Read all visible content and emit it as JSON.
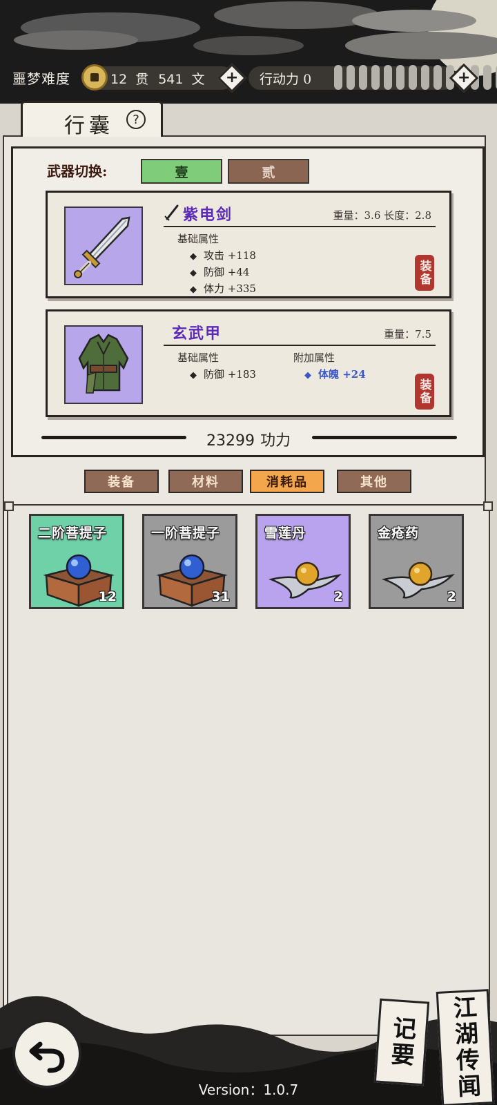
{
  "header": {
    "difficulty": "噩梦难度",
    "money_guan": "12",
    "money_guan_unit": "贯",
    "money_wen": "541",
    "money_wen_unit": "文",
    "action_label": "行动力",
    "action_value": "0",
    "stamina_bars_total": 14
  },
  "panel": {
    "title": "行囊",
    "help": "?"
  },
  "weapon_switch": {
    "label": "武器切换:",
    "options": [
      "壹",
      "贰"
    ],
    "selected": "壹"
  },
  "equipment": [
    {
      "name": "紫电剑",
      "icon": "sword-icon",
      "meta": "重量：3.6  长度：2.8",
      "base_title": "基础属性",
      "base_attrs": [
        "攻击 +118",
        "防御 +44",
        "体力 +335"
      ],
      "extra_title": "",
      "extra_attrs": [],
      "action": "装备",
      "name_color": "#5b2ab8"
    },
    {
      "name": "玄武甲",
      "icon": "armor-icon",
      "meta": "重量：7.5",
      "base_title": "基础属性",
      "base_attrs": [
        "防御 +183"
      ],
      "extra_title": "附加属性",
      "extra_attrs": [
        "体魄 +24"
      ],
      "action": "装备",
      "name_color": "#5b2ab8"
    }
  ],
  "power": {
    "value": "23299",
    "label": "功力"
  },
  "categories": {
    "tabs": [
      "装备",
      "材料",
      "消耗品",
      "其他"
    ],
    "selected": "消耗品"
  },
  "inventory": [
    {
      "name": "二阶菩提子",
      "count": "12",
      "icon": "bodhi-box-icon",
      "bg": "#6ed1a7"
    },
    {
      "name": "一阶菩提子",
      "count": "31",
      "icon": "bodhi-box-icon",
      "bg": "#9b9b9c"
    },
    {
      "name": "雪莲丹",
      "count": "2",
      "icon": "pill-icon",
      "bg": "#b9a3ef"
    },
    {
      "name": "金疮药",
      "count": "2",
      "icon": "pill-icon",
      "bg": "#9b9b9c"
    }
  ],
  "footer": {
    "memo": "记要",
    "rumor": "江湖传闻",
    "version": "Version：1.0.7"
  }
}
